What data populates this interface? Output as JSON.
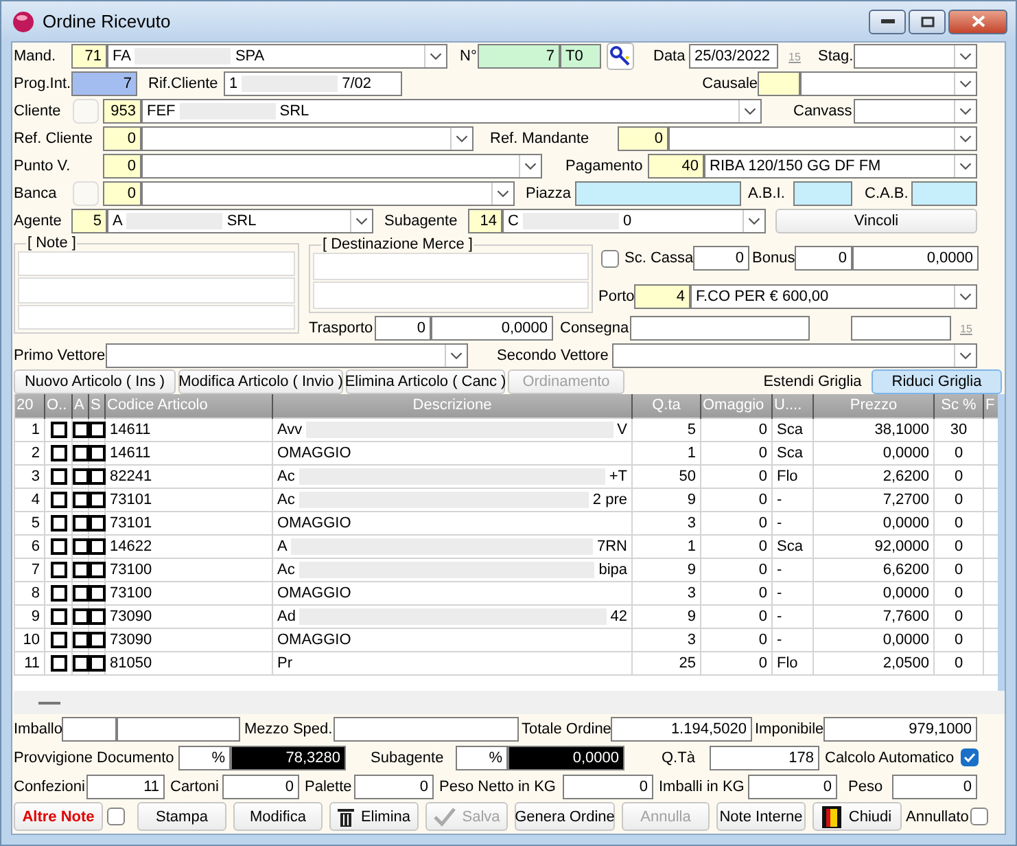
{
  "window": {
    "title": "Ordine Ricevuto"
  },
  "header": {
    "mandante": {
      "label": "Mand.",
      "code": "71",
      "name": [
        "FA",
        "SPA"
      ]
    },
    "numero": {
      "label": "N°",
      "value": "7",
      "series": "T0"
    },
    "data": {
      "label": "Data",
      "value": "25/03/2022",
      "calendar_day": "15"
    },
    "stagione": {
      "label": "Stag."
    },
    "prog_int": {
      "label": "Prog.Int.",
      "value": "7"
    },
    "rif_cliente": {
      "label": "Rif.Cliente",
      "value": [
        "1",
        "7/02"
      ]
    },
    "causale": {
      "label": "Causale"
    },
    "cliente": {
      "label": "Cliente",
      "code": "953",
      "name": [
        "FEF",
        "SRL"
      ]
    },
    "canvass": {
      "label": "Canvass"
    },
    "ref_cliente": {
      "label": "Ref. Cliente",
      "code": "0"
    },
    "ref_mandante": {
      "label": "Ref. Mandante",
      "code": "0"
    },
    "punto_v": {
      "label": "Punto V.",
      "code": "0"
    },
    "pagamento": {
      "label": "Pagamento",
      "code": "40",
      "name": [
        "RIBA 120/150 GG DF FM"
      ]
    },
    "banca": {
      "label": "Banca",
      "code": "0"
    },
    "piazza": {
      "label": "Piazza"
    },
    "abi": {
      "label": "A.B.I."
    },
    "cab": {
      "label": "C.A.B."
    },
    "agente": {
      "label": "Agente",
      "code": "5",
      "name": [
        "A",
        "SRL"
      ]
    },
    "subagente": {
      "label": "Subagente",
      "code": "14",
      "name": [
        "C",
        "0"
      ]
    },
    "vincoli_button": "Vincoli"
  },
  "note": {
    "title": "[ Note ]"
  },
  "destinazione": {
    "title": "[ Destinazione Merce  ]"
  },
  "sconto_cassa": {
    "label": "Sc. Cassa",
    "checked": false,
    "value": "0"
  },
  "bonus": {
    "label": "Bonus",
    "value": "0",
    "amount": "0,0000"
  },
  "porto": {
    "label": "Porto",
    "code": "4",
    "name": [
      "F.CO PER € 600,00"
    ]
  },
  "trasporto": {
    "label": "Trasporto",
    "value": "0",
    "amount": "0,0000"
  },
  "consegna": {
    "label": "Consegna",
    "calendar_day": "15"
  },
  "primo_vettore": {
    "label": "Primo Vettore"
  },
  "secondo_vettore": {
    "label": "Secondo Vettore"
  },
  "grid_toolbar": {
    "buttons": [
      {
        "label": "Nuovo Articolo ( Ins )",
        "disabled": false
      },
      {
        "label": "Modifica Articolo ( Invio )",
        "disabled": false
      },
      {
        "label": "Elimina Articolo ( Canc )",
        "disabled": false
      },
      {
        "label": "Ordinamento",
        "disabled": true
      }
    ],
    "views": [
      {
        "label": "Estendi Griglia",
        "selected": false
      },
      {
        "label": "Riduci Griglia",
        "selected": true
      }
    ]
  },
  "table": {
    "columns": [
      "20",
      "O..",
      "A",
      "S",
      "Codice Articolo",
      "Descrizione",
      "Q.ta",
      "Omaggio",
      "U....",
      "Prezzo",
      "Sc %",
      "F"
    ],
    "rows": [
      {
        "num": "1",
        "checks": [
          false,
          false,
          false
        ],
        "code": "14611",
        "description": [
          "Avv",
          "V"
        ],
        "qty": "5",
        "omaggio": "0",
        "unit": "Sca",
        "price": "38,1000",
        "discount": "30"
      },
      {
        "num": "2",
        "checks": [
          false,
          false,
          false
        ],
        "code": "14611",
        "description": [
          "OMAGGIO"
        ],
        "qty": "1",
        "omaggio": "0",
        "unit": "Sca",
        "price": "0,0000",
        "discount": "0"
      },
      {
        "num": "3",
        "checks": [
          false,
          false,
          false
        ],
        "code": "82241",
        "description": [
          "Ac",
          "+T"
        ],
        "qty": "50",
        "omaggio": "0",
        "unit": "Flo",
        "price": "2,6200",
        "discount": "0"
      },
      {
        "num": "4",
        "checks": [
          false,
          false,
          false
        ],
        "code": "73101",
        "description": [
          "Ac",
          "2 pre"
        ],
        "qty": "9",
        "omaggio": "0",
        "unit": "-",
        "price": "7,2700",
        "discount": "0"
      },
      {
        "num": "5",
        "checks": [
          false,
          false,
          false
        ],
        "code": "73101",
        "description": [
          "OMAGGIO"
        ],
        "qty": "3",
        "omaggio": "0",
        "unit": "-",
        "price": "0,0000",
        "discount": "0"
      },
      {
        "num": "6",
        "checks": [
          false,
          false,
          false
        ],
        "code": "14622",
        "description": [
          "A",
          "7RN"
        ],
        "qty": "1",
        "omaggio": "0",
        "unit": "Sca",
        "price": "92,0000",
        "discount": "0"
      },
      {
        "num": "7",
        "checks": [
          false,
          false,
          false
        ],
        "code": "73100",
        "description": [
          "Ac",
          "bipa"
        ],
        "qty": "9",
        "omaggio": "0",
        "unit": "-",
        "price": "6,6200",
        "discount": "0"
      },
      {
        "num": "8",
        "checks": [
          false,
          false,
          false
        ],
        "code": "73100",
        "description": [
          "OMAGGIO"
        ],
        "qty": "3",
        "omaggio": "0",
        "unit": "-",
        "price": "0,0000",
        "discount": "0"
      },
      {
        "num": "9",
        "checks": [
          false,
          false,
          false
        ],
        "code": "73090",
        "description": [
          "Ad",
          "42"
        ],
        "qty": "9",
        "omaggio": "0",
        "unit": "-",
        "price": "7,7600",
        "discount": "0"
      },
      {
        "num": "10",
        "checks": [
          false,
          false,
          false
        ],
        "code": "73090",
        "description": [
          "OMAGGIO"
        ],
        "qty": "3",
        "omaggio": "0",
        "unit": "-",
        "price": "0,0000",
        "discount": "0"
      },
      {
        "num": "11",
        "checks": [
          false,
          false,
          false
        ],
        "code": "81050",
        "description": [
          "Pr"
        ],
        "qty": "25",
        "omaggio": "0",
        "unit": "Flo",
        "price": "2,0500",
        "discount": "0"
      }
    ]
  },
  "totals": {
    "imballo": {
      "label": "Imballo"
    },
    "mezzo_sped": {
      "label": "Mezzo Sped."
    },
    "totale_ordine": {
      "label": "Totale Ordine",
      "value": "1.194,5020"
    },
    "imponibile": {
      "label": "Imponibile",
      "value": "979,1000"
    },
    "provvigione": {
      "label": "Provvigione Documento",
      "symbol": "%",
      "value": "78,3280"
    },
    "subagente": {
      "label": "Subagente",
      "symbol": "%",
      "value": "0,0000"
    },
    "qta": {
      "label": "Q.Tà",
      "value": "178"
    },
    "calcolo_automatico": {
      "label": "Calcolo Automatico",
      "checked": true
    },
    "confezioni": {
      "label": "Confezioni",
      "value": "11"
    },
    "cartoni": {
      "label": "Cartoni",
      "value": "0"
    },
    "palette": {
      "label": "Palette",
      "value": "0"
    },
    "peso_netto": {
      "label": "Peso Netto in KG",
      "value": "0"
    },
    "imballi": {
      "label": "Imballi in KG",
      "value": "0"
    },
    "peso": {
      "label": "Peso",
      "value": "0"
    }
  },
  "actions": {
    "altre_note": {
      "label": "Altre Note",
      "checked": false
    },
    "buttons": [
      {
        "kind": "plain",
        "label": "Stampa",
        "disabled": false
      },
      {
        "kind": "plain",
        "label": "Modifica",
        "disabled": false
      },
      {
        "kind": "delete",
        "label": "Elimina",
        "disabled": false
      },
      {
        "kind": "save",
        "label": "Salva",
        "disabled": true
      },
      {
        "kind": "plain",
        "label": "Genera Ordine",
        "disabled": false
      },
      {
        "kind": "plain",
        "label": "Annulla",
        "disabled": true
      },
      {
        "kind": "plain",
        "label": "Note Interne",
        "disabled": false
      },
      {
        "kind": "close",
        "label": "Chiudi",
        "disabled": false
      }
    ],
    "annullato": {
      "label": "Annullato",
      "checked": false
    }
  }
}
